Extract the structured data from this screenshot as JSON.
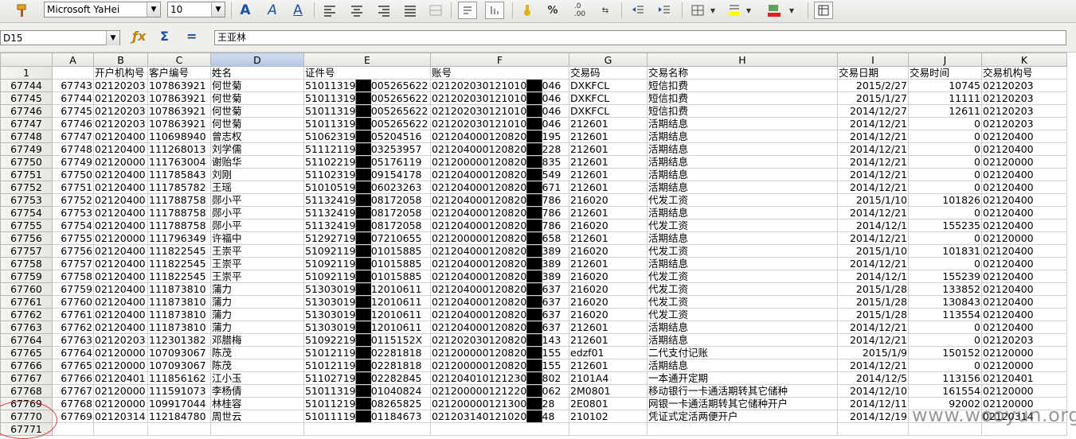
{
  "toolbar": {
    "font_name": "Microsoft YaHei",
    "font_size": "10",
    "icons": [
      "paintbrush-icon",
      "bold-a-icon",
      "italic-a-icon",
      "underline-a-icon",
      "align-left-icon",
      "align-center-icon",
      "align-right-icon",
      "align-justify-icon",
      "merge-cells-icon",
      "wrap-text-icon",
      "number-format-icon",
      "currency-icon",
      "percent-icon",
      "decimal-add-icon",
      "decimal-remove-icon",
      "indent-decrease-icon",
      "indent-increase-icon",
      "borders-icon",
      "highlight-icon",
      "font-color-icon",
      "freeze-panes-icon"
    ],
    "percent_label": "%"
  },
  "formula_bar": {
    "cell_ref": "D15",
    "formula_value": "王亚林"
  },
  "columns": [
    "A",
    "B",
    "C",
    "D",
    "E",
    "F",
    "G",
    "H",
    "I",
    "J",
    "K"
  ],
  "selected_column": "D",
  "header_row": {
    "row_label": "1",
    "cells": [
      "",
      "开户机构号",
      "客户编号",
      "姓名",
      "证件号",
      "账号",
      "交易码",
      "交易名称",
      "交易日期",
      "交易时间",
      "交易机构号"
    ]
  },
  "rows": [
    {
      "r": "67744",
      "cells": [
        "67743",
        "02120203",
        "107863921",
        "何世菊",
        "51011319██005265622",
        "021202030121010██046",
        "DXKFCL",
        "短信扣费",
        "2015/2/27",
        "10745",
        "02120203"
      ]
    },
    {
      "r": "67745",
      "cells": [
        "67744",
        "02120203",
        "107863921",
        "何世菊",
        "51011319██005265622",
        "021202030121010██046",
        "DXKFCL",
        "短信扣费",
        "2015/1/27",
        "11111",
        "02120203"
      ]
    },
    {
      "r": "67746",
      "cells": [
        "67745",
        "02120203",
        "107863921",
        "何世菊",
        "51011319██005265622",
        "021202030121010██046",
        "DXKFCL",
        "短信扣费",
        "2014/12/27",
        "12611",
        "02120203"
      ]
    },
    {
      "r": "67747",
      "cells": [
        "67746",
        "02120203",
        "107863921",
        "何世菊",
        "51011319██005265622",
        "021202030121010██046",
        "212601",
        "活期结息",
        "2014/12/21",
        "0",
        "02120203"
      ]
    },
    {
      "r": "67748",
      "cells": [
        "67747",
        "02120400",
        "110698940",
        "曾志权",
        "51062319██05204516",
        "021204000120820██195",
        "212601",
        "活期结息",
        "2014/12/21",
        "0",
        "02120400"
      ]
    },
    {
      "r": "67749",
      "cells": [
        "67748",
        "02120400",
        "111268013",
        "刘学儒",
        "51112119██03253957",
        "021204000120820██228",
        "212601",
        "活期结息",
        "2014/12/21",
        "0",
        "02120400"
      ]
    },
    {
      "r": "67750",
      "cells": [
        "67749",
        "02120000",
        "111763004",
        "谢贻华",
        "51102219██05176119",
        "021200000120820██835",
        "212601",
        "活期结息",
        "2014/12/21",
        "0",
        "02120000"
      ]
    },
    {
      "r": "67751",
      "cells": [
        "67750",
        "02120400",
        "111785843",
        "刘刚",
        "51102319██09154178",
        "021204000120820██549",
        "212601",
        "活期结息",
        "2014/12/21",
        "0",
        "02120400"
      ]
    },
    {
      "r": "67752",
      "cells": [
        "67751",
        "02120400",
        "111785782",
        "王瑶",
        "51010519██06023263",
        "021204000120820██671",
        "212601",
        "活期结息",
        "2014/12/21",
        "0",
        "02120400"
      ]
    },
    {
      "r": "67753",
      "cells": [
        "67752",
        "02120400",
        "111788758",
        "郧小平",
        "51132419██08172058",
        "021204000120820██786",
        "216020",
        "代发工资",
        "2015/1/10",
        "101826",
        "02120400"
      ]
    },
    {
      "r": "67754",
      "cells": [
        "67753",
        "02120400",
        "111788758",
        "郧小平",
        "51132419██08172058",
        "021204000120820██786",
        "212601",
        "活期结息",
        "2014/12/21",
        "0",
        "02120400"
      ]
    },
    {
      "r": "67755",
      "cells": [
        "67754",
        "02120400",
        "111788758",
        "郧小平",
        "51132419██08172058",
        "021204000120820██786",
        "216020",
        "代发工资",
        "2014/12/1",
        "155235",
        "02120400"
      ]
    },
    {
      "r": "67756",
      "cells": [
        "67755",
        "02120000",
        "111796349",
        "许福中",
        "51292719██07210655",
        "021200000120820██658",
        "212601",
        "活期结息",
        "2014/12/21",
        "0",
        "02120000"
      ]
    },
    {
      "r": "67757",
      "cells": [
        "67756",
        "02120400",
        "111822545",
        "王崇平",
        "51092119██01015885",
        "021204000120820██389",
        "216020",
        "代发工资",
        "2015/1/10",
        "101831",
        "02120400"
      ]
    },
    {
      "r": "67758",
      "cells": [
        "67757",
        "02120400",
        "111822545",
        "王崇平",
        "51092119██01015885",
        "021204000120820██389",
        "212601",
        "活期结息",
        "2014/12/21",
        "0",
        "02120400"
      ]
    },
    {
      "r": "67759",
      "cells": [
        "67758",
        "02120400",
        "111822545",
        "王崇平",
        "51092119██01015885",
        "021204000120820██389",
        "216020",
        "代发工资",
        "2014/12/1",
        "155239",
        "02120400"
      ]
    },
    {
      "r": "67760",
      "cells": [
        "67759",
        "02120400",
        "111873810",
        "蒲力",
        "51303019██12010611",
        "021204000120820██637",
        "216020",
        "代发工资",
        "2015/1/28",
        "133852",
        "02120400"
      ]
    },
    {
      "r": "67761",
      "cells": [
        "67760",
        "02120400",
        "111873810",
        "蒲力",
        "51303019██12010611",
        "021204000120820██637",
        "216020",
        "代发工资",
        "2015/1/28",
        "130843",
        "02120400"
      ]
    },
    {
      "r": "67762",
      "cells": [
        "67761",
        "02120400",
        "111873810",
        "蒲力",
        "51303019██12010611",
        "021204000120820██637",
        "216020",
        "代发工资",
        "2015/1/28",
        "113554",
        "02120400"
      ]
    },
    {
      "r": "67763",
      "cells": [
        "67762",
        "02120400",
        "111873810",
        "蒲力",
        "51303019██12010611",
        "021204000120820██637",
        "212601",
        "活期结息",
        "2014/12/21",
        "0",
        "02120400"
      ]
    },
    {
      "r": "67764",
      "cells": [
        "67763",
        "02120203",
        "112301382",
        "邓腊梅",
        "51092219██0115152X",
        "021202030120820██143",
        "212601",
        "活期结息",
        "2014/12/21",
        "0",
        "02120203"
      ]
    },
    {
      "r": "67765",
      "cells": [
        "67764",
        "02120000",
        "107093067",
        "陈茂",
        "51012119██02281818",
        "021200000120820██155",
        "edzf01",
        "二代支付记账",
        "2015/1/9",
        "150152",
        "02120000"
      ]
    },
    {
      "r": "67766",
      "cells": [
        "67765",
        "02120000",
        "107093067",
        "陈茂",
        "51012119██02281818",
        "021200000120820██155",
        "212601",
        "活期结息",
        "2014/12/21",
        "0",
        "02120000"
      ]
    },
    {
      "r": "67767",
      "cells": [
        "67766",
        "02120401",
        "111856162",
        "江小玉",
        "51102719██02282845",
        "021204010121230██802",
        "2101A4",
        "一本通开定期",
        "2014/12/5",
        "113156",
        "02120401"
      ]
    },
    {
      "r": "67768",
      "cells": [
        "67767",
        "02120000",
        "111591073",
        "李杨倩",
        "51011319██01040824",
        "021200000121220██062",
        "2M0801",
        "移动银行一卡通活期转其它储种",
        "2014/12/10",
        "161554",
        "02120000"
      ]
    },
    {
      "r": "67769",
      "cells": [
        "67768",
        "02120000",
        "109917044",
        "林桂容",
        "51011219██08265825",
        "021200000121300██28",
        "2E0801",
        "网银一卡通活期转其它储种开户",
        "2014/12/11",
        "92002",
        "02120000"
      ]
    },
    {
      "r": "67770",
      "cells": [
        "67769",
        "02120314",
        "112184780",
        "周世云",
        "51011119██01184673",
        "021203140121020██48",
        "210102",
        "凭证式定活两便开户",
        "2014/12/19",
        "",
        "02120314"
      ]
    },
    {
      "r": "67771",
      "cells": [
        "",
        "",
        "",
        "",
        "",
        "",
        "",
        "",
        "",
        "",
        ""
      ]
    }
  ],
  "watermark": "www.wooyun.org",
  "colors": {
    "selected_column_header": "#b5c7e6",
    "annotation_circle": "#e03a3a"
  }
}
